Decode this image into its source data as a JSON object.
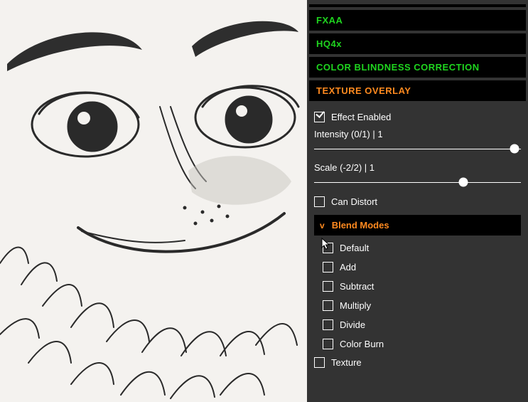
{
  "sections": {
    "fxaa": {
      "label": "FXAA"
    },
    "hq4x": {
      "label": "HQ4x"
    },
    "cbc": {
      "label": "COLOR BLINDNESS CORRECTION"
    },
    "tex": {
      "label": "TEXTURE OVERLAY"
    }
  },
  "tex_body": {
    "effect_enabled": {
      "label": "Effect Enabled",
      "checked": true
    },
    "intensity": {
      "label": "Intensity  (0/1) | 1",
      "pos": 0.97
    },
    "scale": {
      "label": "Scale  (-2/2) | 1",
      "pos": 0.72
    },
    "can_distort": {
      "label": "Can Distort",
      "checked": false
    },
    "blend_modes": {
      "header": "Blend Modes",
      "chev": "v",
      "items": [
        {
          "label": "Default",
          "checked": false
        },
        {
          "label": "Add",
          "checked": false
        },
        {
          "label": "Subtract",
          "checked": false
        },
        {
          "label": "Multiply",
          "checked": false
        },
        {
          "label": "Divide",
          "checked": false
        },
        {
          "label": "Color Burn",
          "checked": false
        }
      ]
    },
    "texture": {
      "label": "Texture",
      "checked": false
    }
  }
}
